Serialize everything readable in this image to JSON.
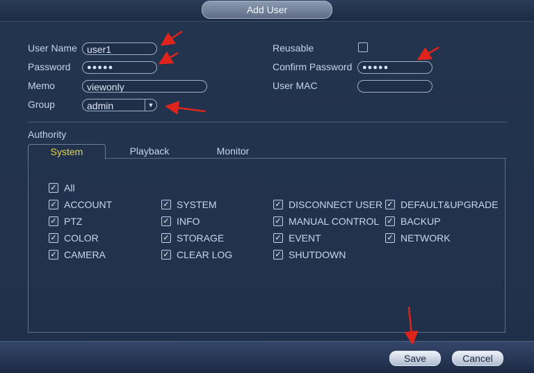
{
  "dialog": {
    "title": "Add User"
  },
  "form": {
    "username": {
      "label": "User Name",
      "value": "user1"
    },
    "password": {
      "label": "Password",
      "value": "●●●●●"
    },
    "memo": {
      "label": "Memo",
      "value": "viewonly"
    },
    "group": {
      "label": "Group",
      "value": "admin"
    },
    "reusable": {
      "label": "Reusable"
    },
    "confirm_password": {
      "label": "Confirm Password",
      "value": "●●●●●"
    },
    "user_mac": {
      "label": "User MAC",
      "value": ""
    }
  },
  "authority": {
    "label": "Authority",
    "tabs": [
      "System",
      "Playback",
      "Monitor"
    ],
    "active_tab": "System",
    "all_label": "All",
    "permissions": [
      [
        "ACCOUNT",
        "SYSTEM",
        "DISCONNECT USER",
        "DEFAULT&UPGRADE"
      ],
      [
        "PTZ",
        "INFO",
        "MANUAL CONTROL",
        "BACKUP"
      ],
      [
        "COLOR",
        "STORAGE",
        "EVENT",
        "NETWORK"
      ],
      [
        "CAMERA",
        "CLEAR LOG",
        "SHUTDOWN"
      ]
    ]
  },
  "buttons": {
    "save": "Save",
    "cancel": "Cancel"
  },
  "check_glyph": "✓",
  "colors": {
    "annotation_arrow": "#e0241b",
    "active_tab_text": "#e2d64a"
  }
}
